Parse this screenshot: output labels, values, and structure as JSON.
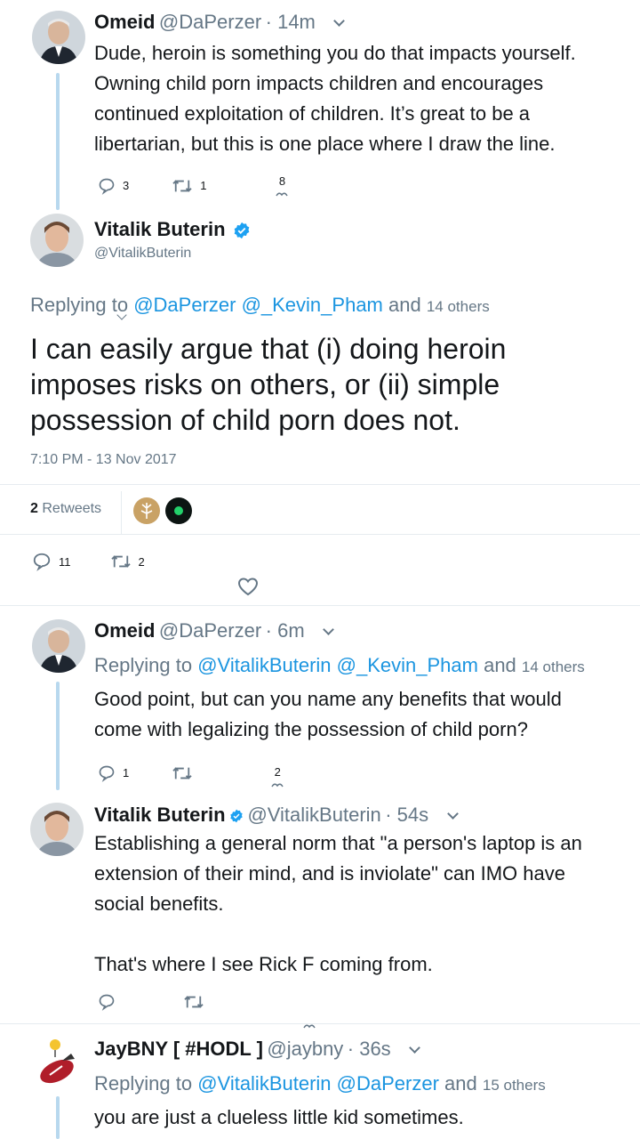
{
  "tweet1": {
    "name": "Omeid",
    "handle": "@DaPerzer",
    "time": "· 14m",
    "lines": [
      "Dude, heroin is something you do that impacts yourself.",
      "Owning child porn impacts children and encourages",
      "continued exploitation of children. It’s great to be a",
      "libertarian, but this is one place where I draw the line."
    ],
    "replies": "3",
    "retweets": "1",
    "likes": "8"
  },
  "main": {
    "name": "Vitalik Buterin",
    "handle": "@VitalikButerin",
    "replying_prefix": "Replying to",
    "replying_handles": "@DaPerzer @_Kevin_Pham",
    "replying_and": "and",
    "replying_others": "14 others",
    "text_lines": [
      "I can easily argue that (i) doing heroin",
      "imposes risks on others, or (ii) simple",
      "possession of child porn does not."
    ],
    "timestamp": "7:10 PM - 13 Nov 2017",
    "retweets_count": "2",
    "retweets_label": "Retweets",
    "replies": "11",
    "retweets": "2"
  },
  "tweet3": {
    "name": "Omeid",
    "handle": "@DaPerzer",
    "time": "· 6m",
    "replying_prefix": "Replying to",
    "replying_handles": "@VitalikButerin @_Kevin_Pham",
    "replying_and": "and",
    "replying_others": "14 others",
    "lines": [
      "Good point, but can you name any benefits that would",
      "come with legalizing the possession of child porn?"
    ],
    "replies": "1",
    "likes": "2"
  },
  "tweet4": {
    "name": "Vitalik Buterin",
    "handle": "@VitalikButerin",
    "time": "· 54s",
    "lines": [
      "Establishing a general norm that \"a person's laptop is an",
      "extension of their mind, and is inviolate\" can IMO have",
      "social benefits."
    ],
    "line_last": "That's where I see Rick F coming from."
  },
  "tweet5": {
    "name": "JayBNY [ #HODL ]",
    "handle": "@jaybny",
    "time": "· 36s",
    "replying_prefix": "Replying to",
    "replying_handles": "@VitalikButerin @DaPerzer",
    "replying_and": "and",
    "replying_others": "15 others",
    "line": "you are just a clueless little kid sometimes."
  },
  "colors": {
    "link": "#1b95e0",
    "grey": "#657786",
    "thread": "#b8d8ee",
    "verified": "#1da1f2"
  },
  "icons": [
    "reply-icon",
    "retweet-icon",
    "like-icon",
    "verified-icon",
    "chevron-down-icon"
  ]
}
